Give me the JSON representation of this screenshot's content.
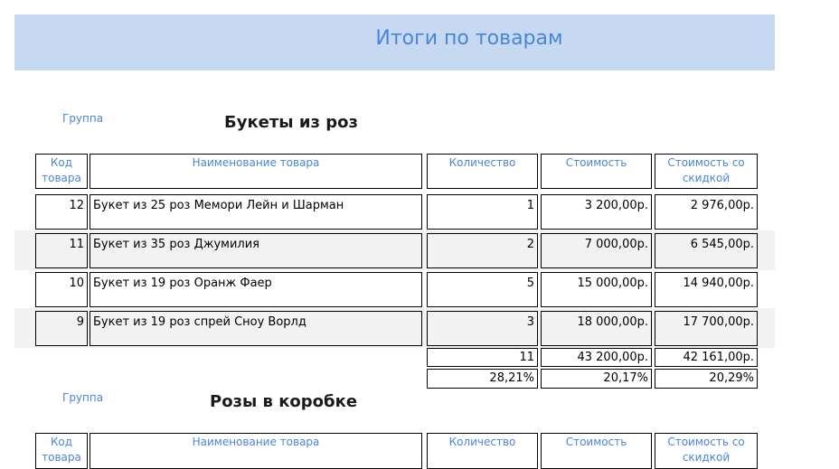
{
  "report": {
    "title": "Итоги по товарам"
  },
  "headers": {
    "code": "Код товара",
    "name": "Наименование товара",
    "qty": "Количество",
    "cost": "Стоимость",
    "discount": "Стоимость со скидкой"
  },
  "groups": [
    {
      "group_label": "Группа",
      "name": "Букеты из роз",
      "rows": [
        {
          "code": "12",
          "name": "Букет из 25 роз Мемори Лейн и Шарман",
          "qty": "1",
          "cost": "3 200,00р.",
          "discount": "2 976,00р."
        },
        {
          "code": "11",
          "name": "Букет из 35 роз Джумилия",
          "qty": "2",
          "cost": "7 000,00р.",
          "discount": "6 545,00р."
        },
        {
          "code": "10",
          "name": "Букет из 19 роз Оранж Фаер",
          "qty": "5",
          "cost": "15 000,00р.",
          "discount": "14 940,00р."
        },
        {
          "code": "9",
          "name": "Букет из 19 роз спрей Сноу Ворлд",
          "qty": "3",
          "cost": "18 000,00р.",
          "discount": "17 700,00р."
        }
      ],
      "totals": {
        "qty": "11",
        "cost": "43 200,00р.",
        "discount": "42 161,00р."
      },
      "percent": {
        "qty": "28,21%",
        "cost": "20,17%",
        "discount": "20,29%"
      }
    },
    {
      "group_label": "Группа",
      "name": "Розы в коробке"
    }
  ]
}
